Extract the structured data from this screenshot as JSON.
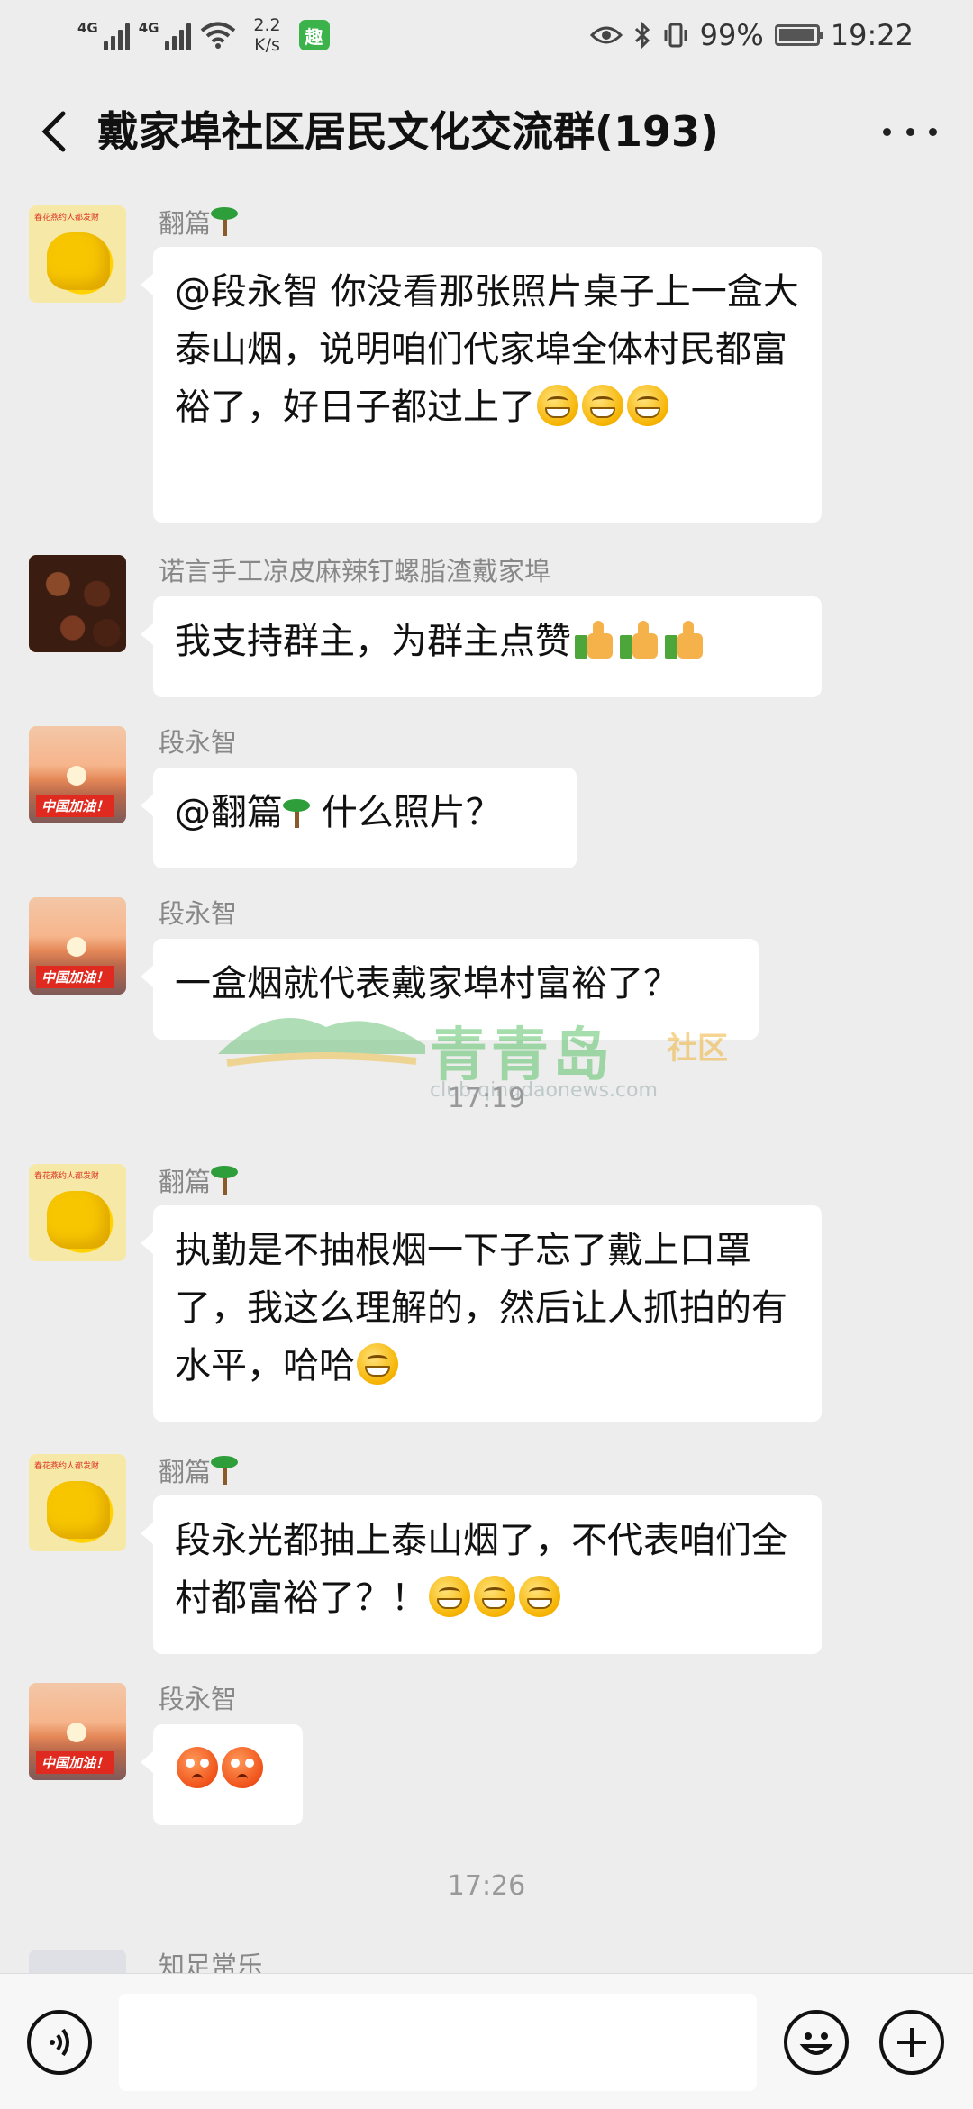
{
  "status_bar": {
    "net1": "4G",
    "net2": "4G",
    "speed_value": "2.2",
    "speed_unit": "K/s",
    "battery": "99%",
    "time": "19:22"
  },
  "header": {
    "title": "戴家埠社区居民文化交流群(193)"
  },
  "messages": [
    {
      "sender": "翻篇",
      "avatar": "golden-ox",
      "text": "@段永智 你没看那张照片桌子上一盒大泰山烟，说明咱们代家埠全体村民都富裕了，好日子都过上了",
      "emojis": [
        "grin",
        "grin",
        "grin"
      ]
    },
    {
      "sender": "诺言手工凉皮麻辣钉螺脂渣戴家埠",
      "avatar": "beans",
      "text": "我支持群主，为群主点赞",
      "emojis": [
        "thumbs-up",
        "thumbs-up",
        "thumbs-up"
      ]
    },
    {
      "sender": "段永智",
      "avatar": "sunset",
      "text_before": "@翻篇",
      "text": " 什么照片？"
    },
    {
      "sender": "段永智",
      "avatar": "sunset",
      "text": "一盒烟就代表戴家埠村富裕了？"
    },
    {
      "sender": "翻篇",
      "avatar": "golden-ox",
      "text": "执勤是不抽根烟一下子忘了戴上口罩了，我这么理解的，然后让人抓拍的有水平，哈哈",
      "emojis": [
        "grin"
      ]
    },
    {
      "sender": "翻篇",
      "avatar": "golden-ox",
      "text": "段永光都抽上泰山烟了，不代表咱们全村都富裕了？！",
      "emojis": [
        "grin",
        "grin",
        "grin"
      ]
    },
    {
      "sender": "段永智",
      "avatar": "sunset",
      "text": "",
      "emojis": [
        "flushed",
        "flushed"
      ]
    },
    {
      "sender": "知足常乐",
      "avatar": "light"
    }
  ],
  "timestamps": [
    "17:19",
    "17:26"
  ],
  "avatar_labels": {
    "golden_ox": "春花燕约人都发财",
    "sunset": "中国加油！"
  },
  "watermark": {
    "brand": "青青岛",
    "sub": "社区",
    "url": "club.qingdaonews.com"
  },
  "colors": {
    "background": "#ededed",
    "bubble": "#ffffff",
    "name_text": "#888888",
    "timestamp": "#999999"
  }
}
